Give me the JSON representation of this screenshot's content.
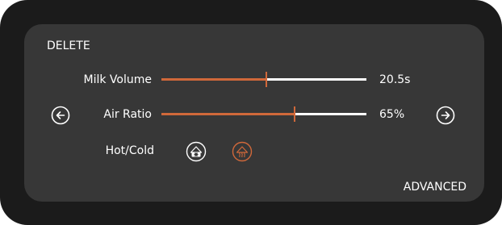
{
  "header": {
    "delete_label": "DELETE"
  },
  "controls": {
    "milk_volume": {
      "label": "Milk Volume",
      "value": "20.5s",
      "level": 0.51
    },
    "air_ratio": {
      "label": "Air Ratio",
      "value": "65%",
      "level": 0.65
    },
    "hot_cold": {
      "label": "Hot/Cold",
      "options": [
        "snowflake-icon",
        "steam-icon"
      ],
      "selected": "steam-icon"
    }
  },
  "nav": {
    "prev_icon": "arrow-left-circle-icon",
    "next_icon": "arrow-right-circle-icon"
  },
  "footer": {
    "advanced_label": "ADVANCED"
  },
  "colors": {
    "accent": "#d0683a",
    "panel": "#373737",
    "bezel": "#1b1b1b",
    "text": "#ffffff"
  }
}
